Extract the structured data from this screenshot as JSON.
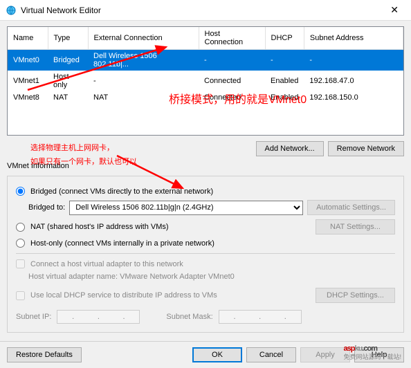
{
  "window": {
    "title": "Virtual Network Editor"
  },
  "table": {
    "headers": [
      "Name",
      "Type",
      "External Connection",
      "Host Connection",
      "DHCP",
      "Subnet Address"
    ],
    "rows": [
      {
        "name": "VMnet0",
        "type": "Bridged",
        "ext": "Dell Wireless 1506 802.11b|...",
        "host": "-",
        "dhcp": "-",
        "subnet": "-",
        "selected": true
      },
      {
        "name": "VMnet1",
        "type": "Host-only",
        "ext": "-",
        "host": "Connected",
        "dhcp": "Enabled",
        "subnet": "192.168.47.0",
        "selected": false
      },
      {
        "name": "VMnet8",
        "type": "NAT",
        "ext": "NAT",
        "host": "Connected",
        "dhcp": "Enabled",
        "subnet": "192.168.150.0",
        "selected": false
      }
    ]
  },
  "buttons": {
    "add_network": "Add Network...",
    "remove_network": "Remove Network",
    "automatic": "Automatic Settings...",
    "nat": "NAT Settings...",
    "dhcp": "DHCP Settings...",
    "restore": "Restore Defaults",
    "ok": "OK",
    "cancel": "Cancel",
    "apply": "Apply",
    "help": "Help"
  },
  "group": {
    "title": "VMnet Information",
    "bridged": "Bridged (connect VMs directly to the external network)",
    "bridged_to": "Bridged to:",
    "bridged_select": "Dell Wireless 1506 802.11b|g|n (2.4GHz)",
    "nat": "NAT (shared host's IP address with VMs)",
    "hostonly": "Host-only (connect VMs internally in a private network)",
    "connect_host": "Connect a host virtual adapter to this network",
    "adapter_name": "Host virtual adapter name: VMware Network Adapter VMnet0",
    "use_dhcp": "Use local DHCP service to distribute IP address to VMs",
    "subnet_ip": "Subnet IP:",
    "subnet_mask": "Subnet Mask:"
  },
  "annotations": {
    "a1": "桥接模式，用的就是VMnet0",
    "a2_l1": "选择物理主机上网网卡，",
    "a2_l2": "如果只有一个网卡，默认也可以"
  },
  "watermark": {
    "text1": "asp",
    "text2": "ku",
    "text3": ".com",
    "sub": "免费网站源码下载站!"
  }
}
